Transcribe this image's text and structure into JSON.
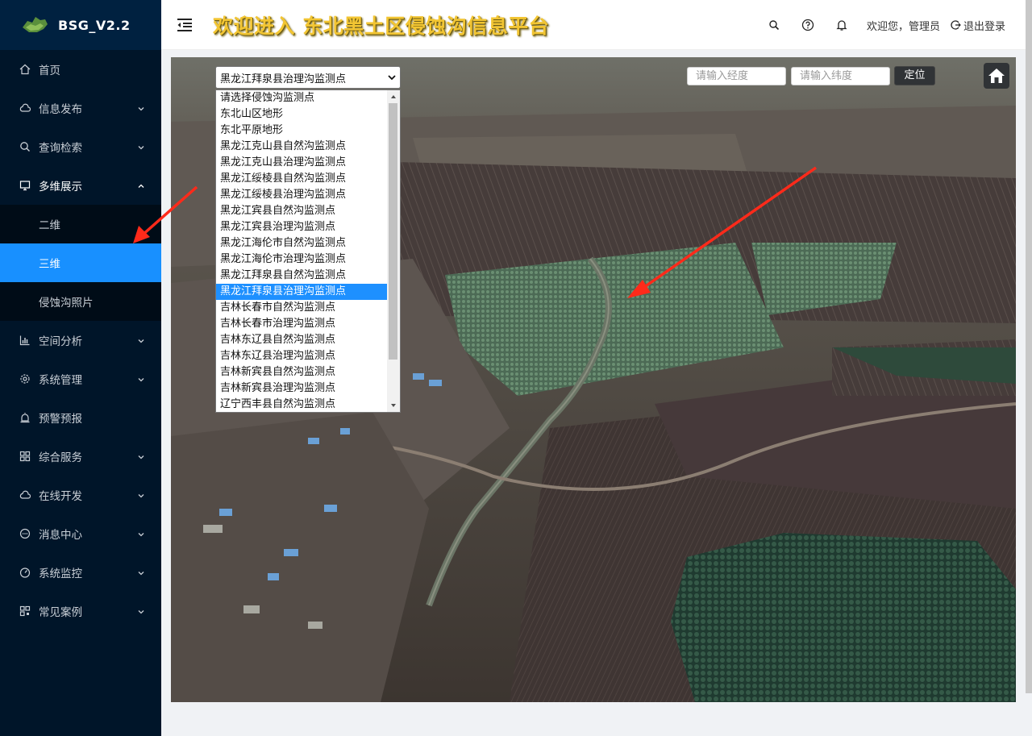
{
  "app": {
    "name": "BSG_V2.2"
  },
  "header": {
    "title": "欢迎进入 东北黑土区侵蚀沟信息平台",
    "welcome": "欢迎您，管理员",
    "logout": "退出登录"
  },
  "sidebar": {
    "items": [
      {
        "label": "首页",
        "icon": "home-icon"
      },
      {
        "label": "信息发布",
        "icon": "cloud-icon"
      },
      {
        "label": "查询检索",
        "icon": "search-icon"
      },
      {
        "label": "多维展示",
        "icon": "monitor-icon"
      },
      {
        "label": "空间分析",
        "icon": "bar-chart-icon"
      },
      {
        "label": "系统管理",
        "icon": "gear-icon"
      },
      {
        "label": "预警预报",
        "icon": "alarm-icon"
      },
      {
        "label": "综合服务",
        "icon": "grid-icon"
      },
      {
        "label": "在线开发",
        "icon": "cloud-icon"
      },
      {
        "label": "消息中心",
        "icon": "chat-icon"
      },
      {
        "label": "系统监控",
        "icon": "dashboard-icon"
      },
      {
        "label": "常见案例",
        "icon": "qrcode-icon"
      }
    ],
    "submenu": [
      "二维",
      "三维",
      "侵蚀沟照片"
    ],
    "active_sub": "三维"
  },
  "map": {
    "select_value": "黑龙江拜泉县治理沟监测点",
    "options": [
      "请选择侵蚀沟监测点",
      "东北山区地形",
      "东北平原地形",
      "黑龙江克山县自然沟监测点",
      "黑龙江克山县治理沟监测点",
      "黑龙江绥棱县自然沟监测点",
      "黑龙江绥棱县治理沟监测点",
      "黑龙江宾县自然沟监测点",
      "黑龙江宾县治理沟监测点",
      "黑龙江海伦市自然沟监测点",
      "黑龙江海伦市治理沟监测点",
      "黑龙江拜泉县自然沟监测点",
      "黑龙江拜泉县治理沟监测点",
      "吉林长春市自然沟监测点",
      "吉林长春市治理沟监测点",
      "吉林东辽县自然沟监测点",
      "吉林东辽县治理沟监测点",
      "吉林新宾县自然沟监测点",
      "吉林新宾县治理沟监测点",
      "辽宁西丰县自然沟监测点"
    ],
    "selected_index": 12,
    "lon_placeholder": "请输入经度",
    "lat_placeholder": "请输入纬度",
    "locate_label": "定位"
  },
  "colors": {
    "sidebar": "#001529",
    "active": "#1890ff",
    "title": "#f2c533"
  }
}
